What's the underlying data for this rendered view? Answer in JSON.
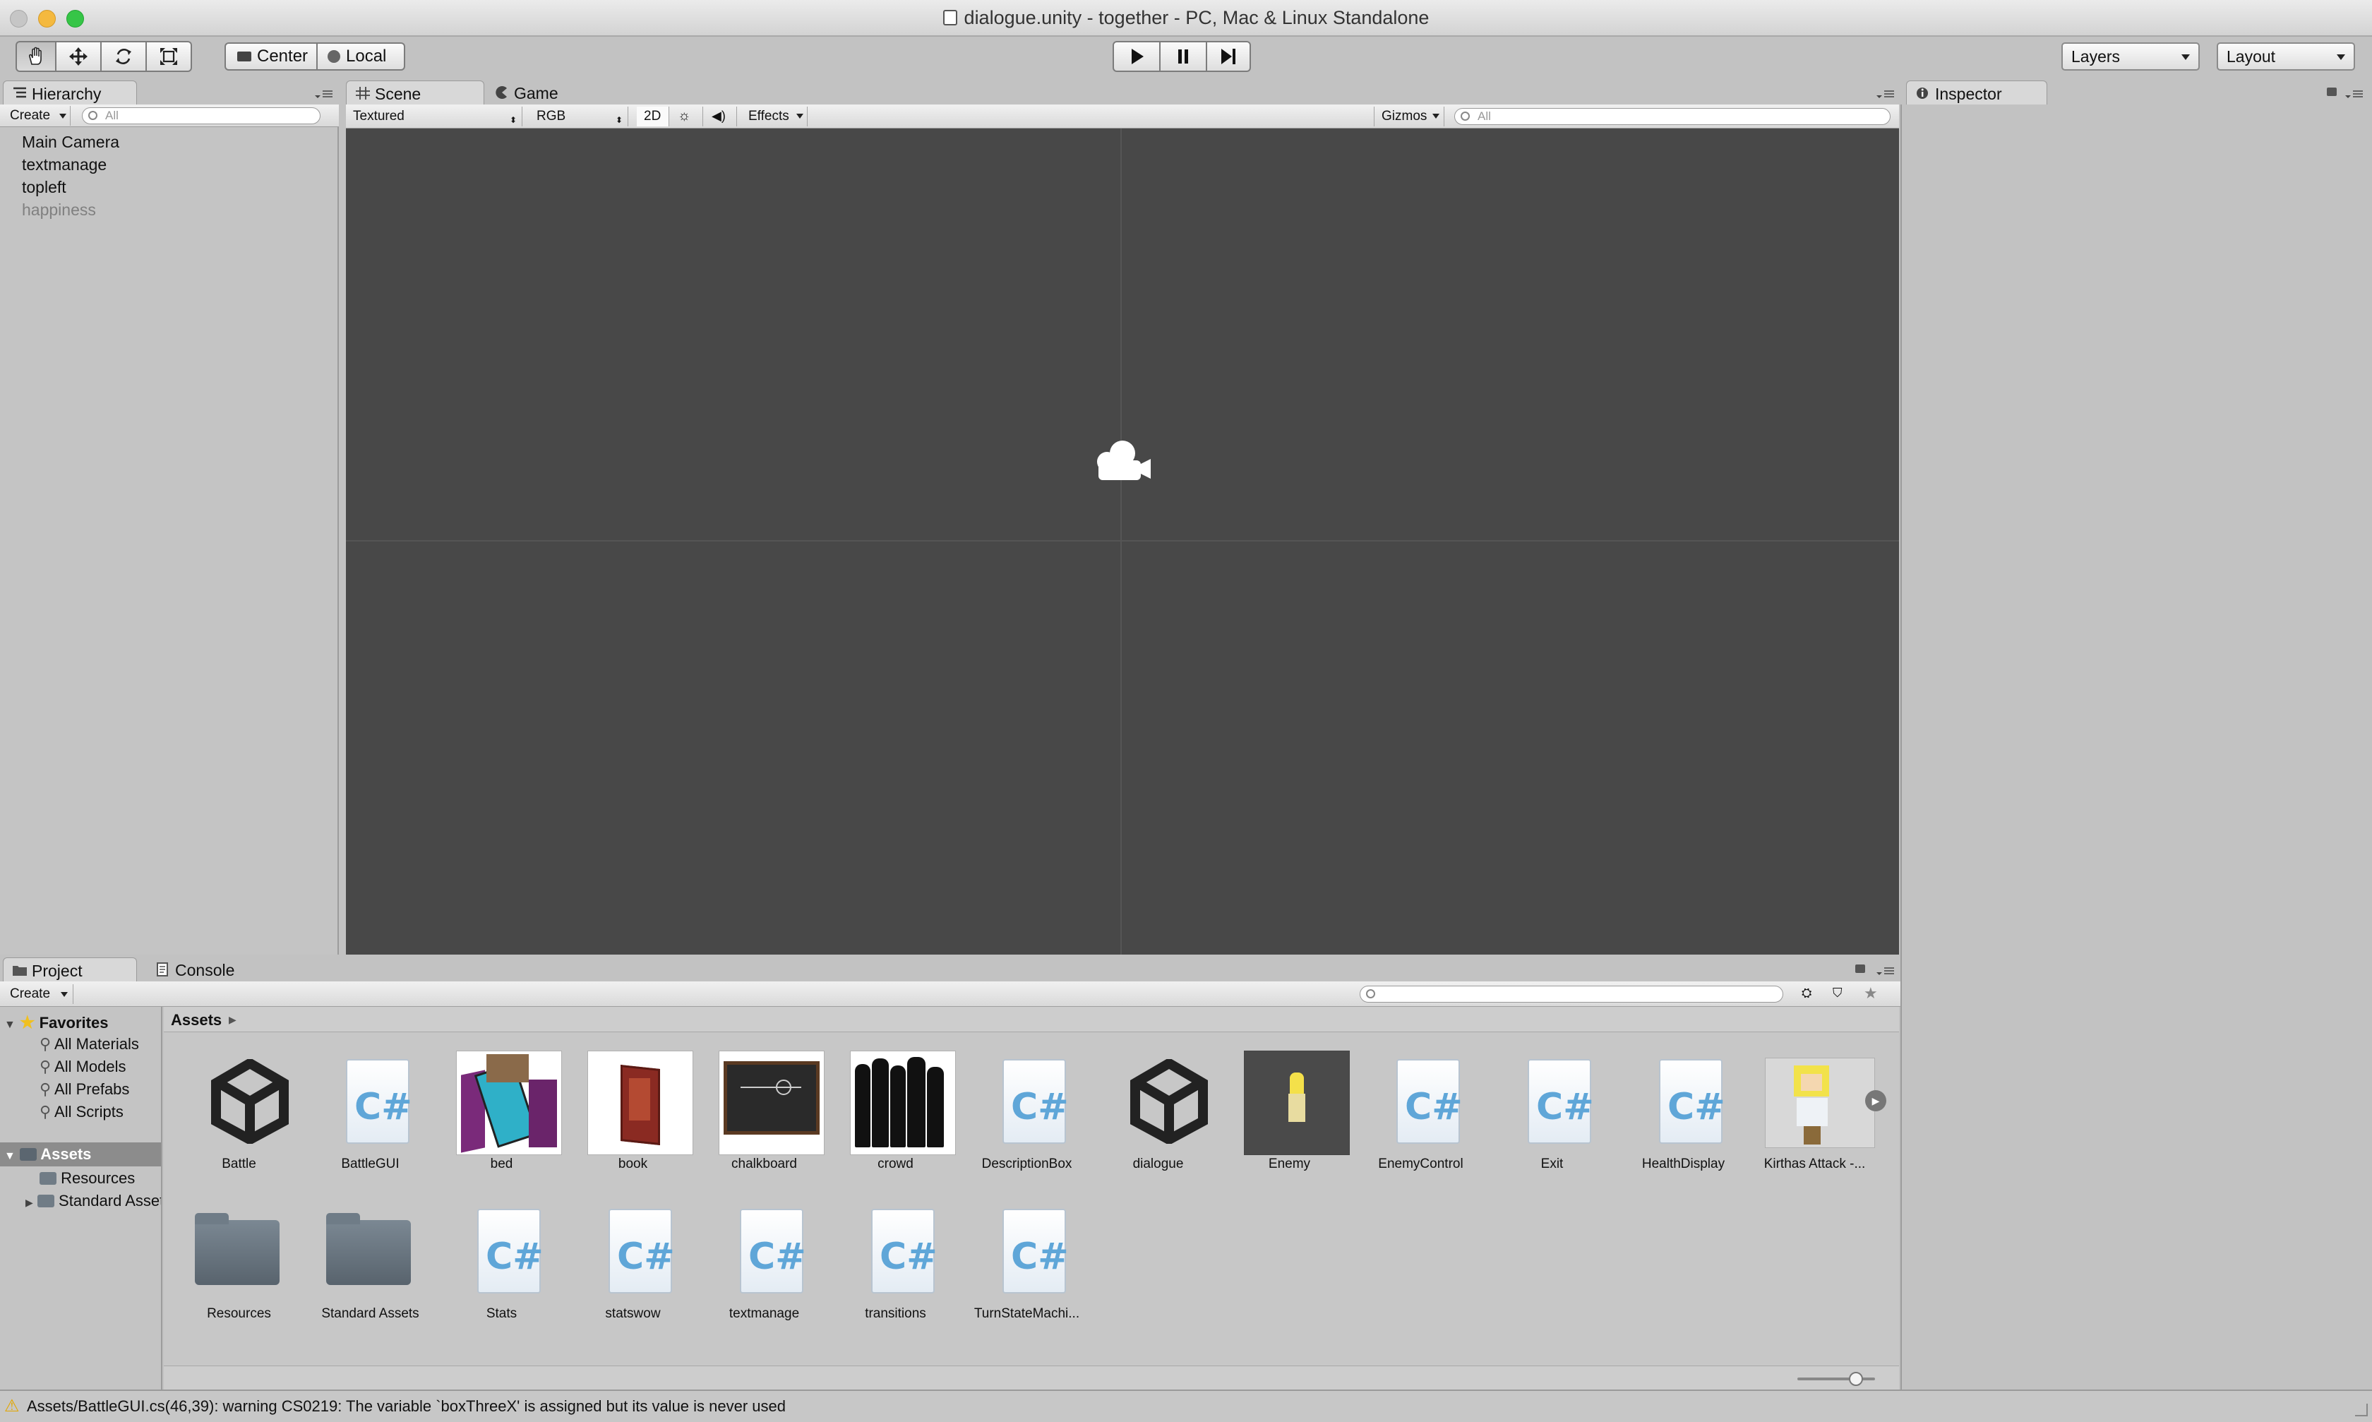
{
  "window": {
    "title": "dialogue.unity - together - PC, Mac & Linux Standalone",
    "traffic_colors": [
      "#c7c7c7",
      "#f2b73f",
      "#2fc340"
    ]
  },
  "toolbar": {
    "tools": [
      "hand-tool",
      "move-tool",
      "rotate-tool",
      "scale-tool"
    ],
    "pivot_label": "Center",
    "space_label": "Local",
    "layers_label": "Layers",
    "layout_label": "Layout"
  },
  "hierarchy": {
    "tab": "Hierarchy",
    "create": "Create",
    "search_placeholder": "All",
    "items": [
      "Main Camera",
      "textmanage",
      "topleft",
      "happiness"
    ]
  },
  "scene": {
    "tab_scene": "Scene",
    "tab_game": "Game",
    "render_mode": "Textured",
    "channel": "RGB",
    "mode_2d": "2D",
    "effects": "Effects",
    "gizmos": "Gizmos",
    "search_placeholder": "All",
    "background": "#484848"
  },
  "inspector": {
    "tab": "Inspector"
  },
  "project": {
    "tab_project": "Project",
    "tab_console": "Console",
    "create": "Create",
    "favorites_label": "Favorites",
    "favorites": [
      "All Materials",
      "All Models",
      "All Prefabs",
      "All Scripts"
    ],
    "assets_label": "Assets",
    "asset_folders": [
      "Resources",
      "Standard Assets"
    ],
    "breadcrumb": "Assets",
    "assets_row1": [
      "Battle",
      "BattleGUI",
      "bed",
      "book",
      "chalkboard",
      "crowd",
      "DescriptionBox",
      "dialogue",
      "Enemy",
      "EnemyControl",
      "Exit",
      "HealthDisplay",
      "Kirthas Attack -..."
    ],
    "assets_row2": [
      "Resources",
      "Standard Assets",
      "Stats",
      "statswow",
      "textmanage",
      "transitions",
      "TurnStateMachi..."
    ],
    "zoom_level": 0.75
  },
  "status": {
    "message": "Assets/BattleGUI.cs(46,39): warning CS0219: The variable `boxThreeX' is assigned but its value is never used"
  }
}
